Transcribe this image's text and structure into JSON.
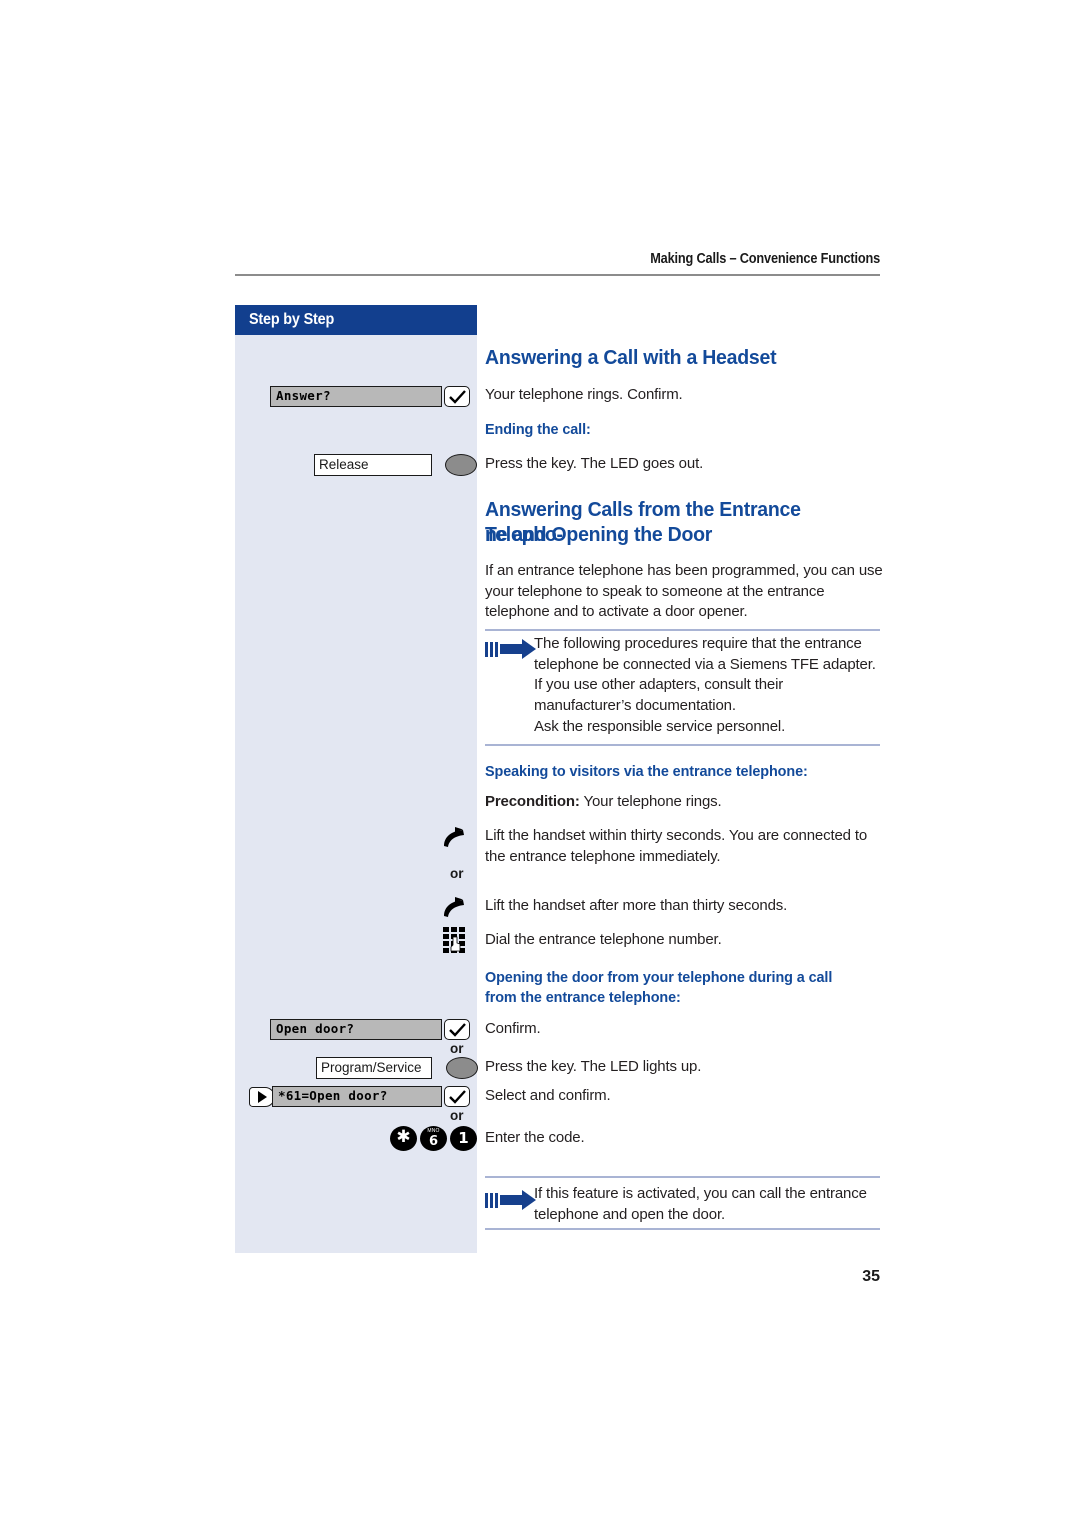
{
  "page": {
    "running_head": "Making Calls – Convenience Functions",
    "page_number": "35"
  },
  "sidebar": {
    "title": "Step by Step",
    "widgets": {
      "answer_display": "Answer?",
      "release_key": "Release",
      "open_door_display": "Open door?",
      "program_service_key": "Program/Service",
      "code_display": "*61=Open door?",
      "or_1": "or",
      "or_2": "or",
      "or_3": "or",
      "keys": [
        {
          "main": "✱",
          "sub": ""
        },
        {
          "main": "6",
          "sub": "MNO"
        },
        {
          "main": "1",
          "sub": ""
        }
      ]
    }
  },
  "content": {
    "section1": {
      "heading": "Answering a Call with a Headset",
      "intro": "Your telephone rings. Confirm.",
      "subheading": "Ending the call:",
      "instruction": "Press the key. The LED goes out."
    },
    "section2": {
      "heading_line1": "Answering Calls from the Entrance Telepho-",
      "heading_line2": "ne and Opening the Door",
      "intro": "If an entrance telephone has been programmed, you can use your telephone to speak to someone at the entrance telephone and to activate a door opener.",
      "note1": {
        "line1": "The following procedures require that the entrance telephone be connected via a Siemens TFE adapter.",
        "line2": "If you use other adapters, consult their manufacturer’s documentation.",
        "line3": "Ask the responsible service personnel."
      },
      "subheading1": "Speaking to visitors via the entrance telephone:",
      "precondition_label": "Precondition:",
      "precondition_text": "Your telephone rings.",
      "step1": "Lift the handset within thirty seconds. You are connected to the entrance telephone immediately.",
      "step2": "Lift the handset after more than thirty seconds.",
      "step3": "Dial the entrance telephone number.",
      "subheading2_line1": "Opening the door from your telephone during a call",
      "subheading2_line2": "from the entrance telephone:",
      "step4": "Confirm.",
      "step5": "Press the key. The LED lights up.",
      "step6": "Select and confirm.",
      "step7": "Enter the code.",
      "note2": {
        "line1": "If this feature is activated, you can call the entrance telephone and open the door."
      }
    }
  },
  "colors": {
    "heading_blue": "#134a9a",
    "sidebar_header_blue": "#123f8e",
    "sidebar_body": "#e3e7f2",
    "rule": "#a9b4d4"
  }
}
